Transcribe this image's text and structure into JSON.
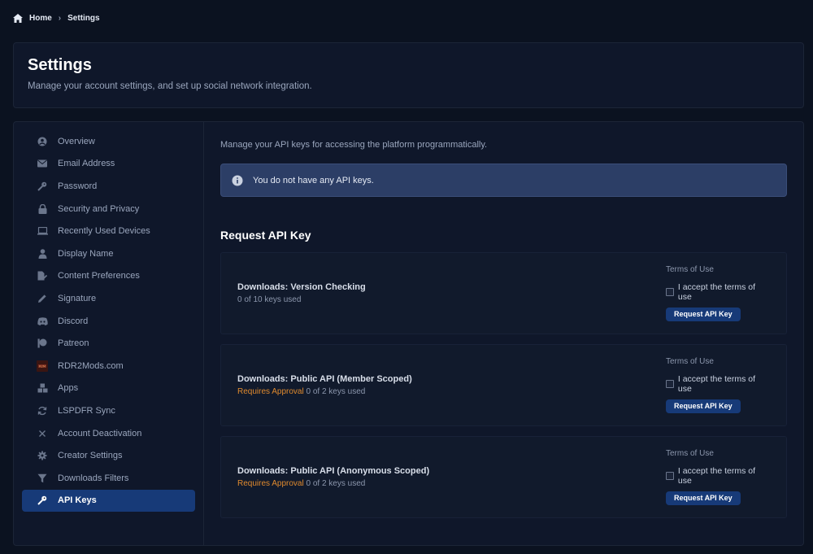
{
  "breadcrumb": {
    "home": "Home",
    "current": "Settings"
  },
  "header": {
    "title": "Settings",
    "subtitle": "Manage your account settings, and set up social network integration."
  },
  "sidebar": {
    "items": [
      {
        "label": "Overview",
        "icon": "user-circle-icon"
      },
      {
        "label": "Email Address",
        "icon": "envelope-icon"
      },
      {
        "label": "Password",
        "icon": "key-icon"
      },
      {
        "label": "Security and Privacy",
        "icon": "lock-icon"
      },
      {
        "label": "Recently Used Devices",
        "icon": "laptop-icon"
      },
      {
        "label": "Display Name",
        "icon": "user-icon"
      },
      {
        "label": "Content Preferences",
        "icon": "file-edit-icon"
      },
      {
        "label": "Signature",
        "icon": "pencil-icon"
      },
      {
        "label": "Discord",
        "icon": "discord-icon"
      },
      {
        "label": "Patreon",
        "icon": "patreon-icon"
      },
      {
        "label": "RDR2Mods.com",
        "icon": "rdr2mods-logo-icon"
      },
      {
        "label": "Apps",
        "icon": "cubes-icon"
      },
      {
        "label": "LSPDFR Sync",
        "icon": "sync-icon"
      },
      {
        "label": "Account Deactivation",
        "icon": "x-icon"
      },
      {
        "label": "Creator Settings",
        "icon": "gear-icon"
      },
      {
        "label": "Downloads Filters",
        "icon": "filter-icon"
      },
      {
        "label": "API Keys",
        "icon": "key-icon"
      }
    ],
    "active_index": 16
  },
  "content": {
    "intro": "Manage your API keys for accessing the platform programmatically.",
    "alert": "You do not have any API keys.",
    "section_title": "Request API Key",
    "keys": [
      {
        "name": "Downloads: Version Checking",
        "approval": "",
        "usage": "0 of 10 keys used"
      },
      {
        "name": "Downloads: Public API (Member Scoped)",
        "approval": "Requires Approval",
        "usage": "0 of 2 keys used"
      },
      {
        "name": "Downloads: Public API (Anonymous Scoped)",
        "approval": "Requires Approval",
        "usage": "0 of 2 keys used"
      }
    ],
    "terms_label": "Terms of Use",
    "accept_label": "I accept the terms of use",
    "button_label": "Request API Key"
  },
  "colors": {
    "background": "#0b1220",
    "card": "#0f172a",
    "accent": "#173a78",
    "approval": "#e08a2e",
    "alert": "#2c3e66"
  }
}
